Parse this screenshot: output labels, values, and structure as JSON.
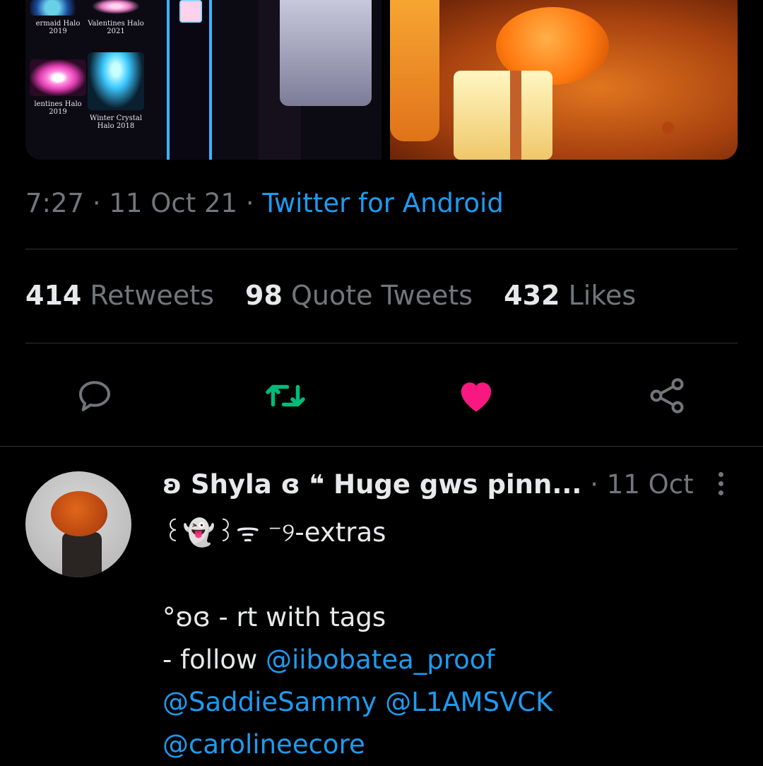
{
  "media": {
    "halo_items": [
      {
        "label": "ermaid Halo\n2019"
      },
      {
        "label": "Valentines Halo\n2021"
      },
      {
        "label": "lentines Halo\n2019"
      },
      {
        "label": "Winter Crystal\nHalo 2018"
      }
    ]
  },
  "tweet": {
    "time": "7:27",
    "date": "11 Oct 21",
    "source": "Twitter for Android",
    "separator": " · "
  },
  "stats": {
    "retweets_count": "414",
    "retweets_label": "Retweets",
    "quotes_count": "98",
    "quotes_label": "Quote Tweets",
    "likes_count": "432",
    "likes_label": "Likes"
  },
  "actions": {
    "icons": [
      "reply-icon",
      "retweet-icon",
      "like-icon",
      "share-icon"
    ],
    "colors": {
      "reply": "#71767b",
      "retweet": "#00ba7c",
      "like": "#f91880",
      "share": "#71767b"
    }
  },
  "reply": {
    "author": "ʚ Shyla ɞ ❝ Huge gws pinn...",
    "date": "11 Oct",
    "line1": "꒰👻꒱ᯤ ⁻୨-extras",
    "line2": "",
    "line3": "°ʚɞ - rt with tags",
    "line4_prefix": "- follow ",
    "mention1": "@iibobatea_proof",
    "mention2": "@SaddieSammy",
    "mention3": "@L1AMSVCK",
    "mention4": "@carolineecore"
  }
}
